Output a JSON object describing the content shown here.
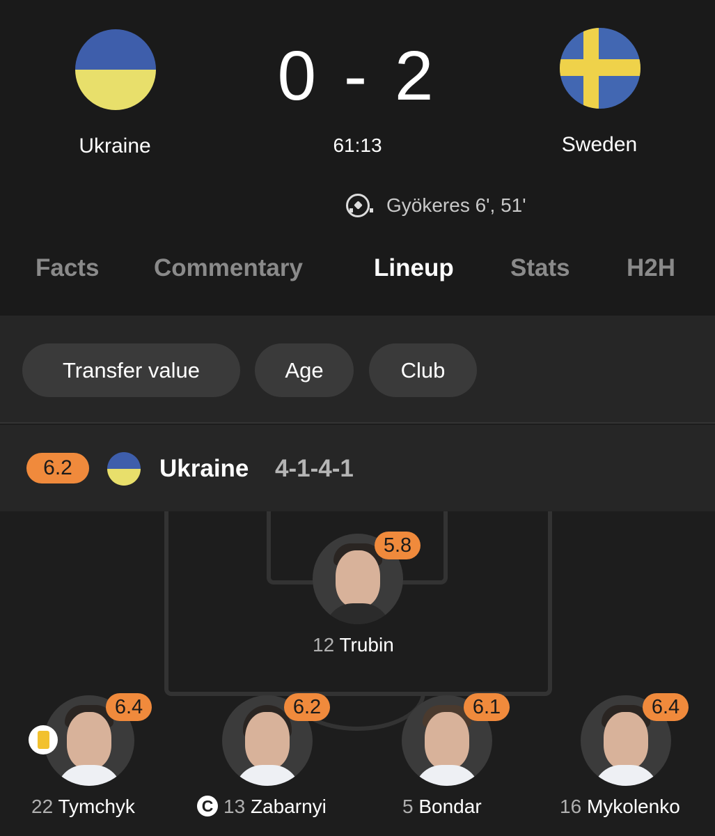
{
  "match": {
    "home": {
      "name": "Ukraine"
    },
    "away": {
      "name": "Sweden"
    },
    "score": "0 - 2",
    "clock": "61:13",
    "scorers": "Gyökeres 6', 51'"
  },
  "tabs": [
    {
      "label": "Facts",
      "active": false
    },
    {
      "label": "Commentary",
      "active": false
    },
    {
      "label": "Lineup",
      "active": true
    },
    {
      "label": "Stats",
      "active": false
    },
    {
      "label": "H2H",
      "active": false
    }
  ],
  "filters": [
    {
      "label": "Transfer value"
    },
    {
      "label": "Age"
    },
    {
      "label": "Club"
    }
  ],
  "lineup": {
    "team_rating": "6.2",
    "team_name": "Ukraine",
    "formation": "4-1-4-1",
    "players": [
      {
        "number": "12",
        "name": "Trubin",
        "rating": "5.8"
      },
      {
        "number": "22",
        "name": "Tymchyk",
        "rating": "6.4",
        "yellow_card": true
      },
      {
        "number": "13",
        "name": "Zabarnyi",
        "rating": "6.2",
        "captain": true,
        "captain_mark": "C"
      },
      {
        "number": "5",
        "name": "Bondar",
        "rating": "6.1"
      },
      {
        "number": "16",
        "name": "Mykolenko",
        "rating": "6.4"
      }
    ]
  },
  "colors": {
    "rating_badge": "#f08a3c",
    "background": "#1d1d1d",
    "ukraine_blue": "#3e5eab",
    "ukraine_yellow": "#e8df6b",
    "sweden_blue": "#4267b2",
    "sweden_yellow": "#efd24a",
    "yellow_card": "#f2c12e"
  }
}
